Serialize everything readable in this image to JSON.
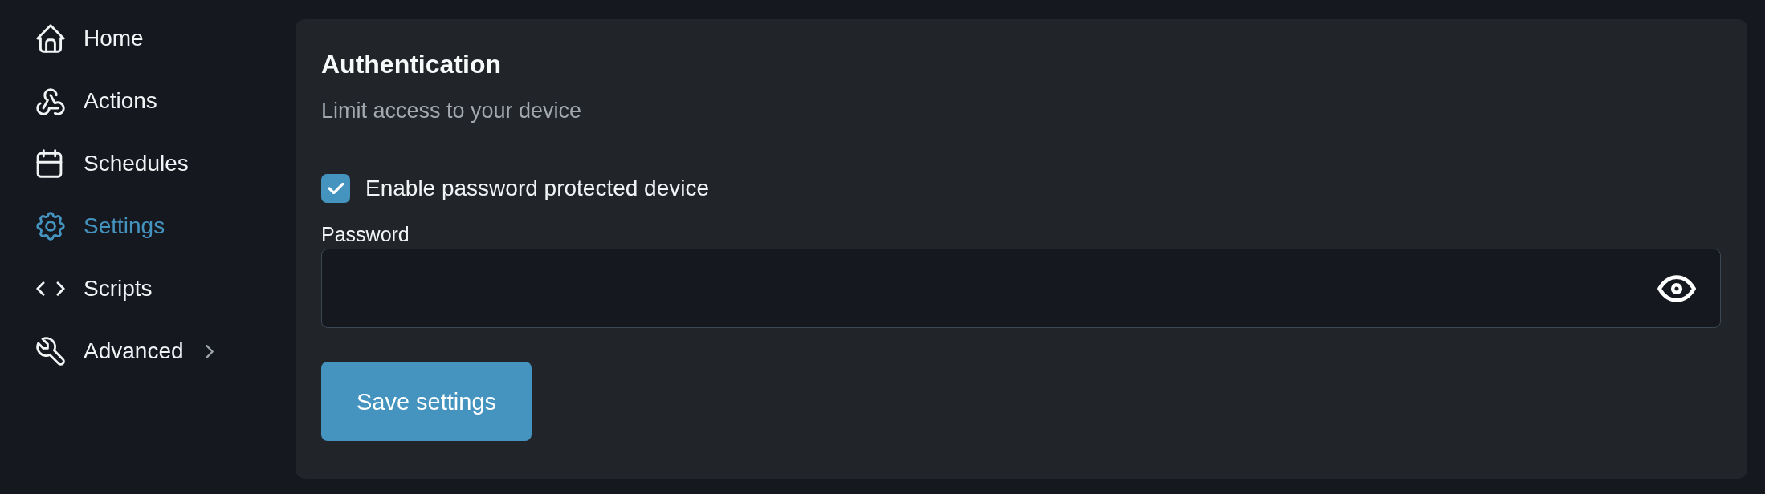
{
  "sidebar": {
    "items": [
      {
        "label": "Home",
        "kind": "link",
        "selected": false
      },
      {
        "label": "Actions",
        "kind": "link",
        "selected": false
      },
      {
        "label": "Schedules",
        "kind": "link",
        "selected": false
      },
      {
        "label": "Settings",
        "kind": "link",
        "selected": true
      },
      {
        "label": "Scripts",
        "kind": "link",
        "selected": false
      },
      {
        "label": "Advanced",
        "kind": "group",
        "selected": false,
        "expanded": false
      }
    ]
  },
  "card": {
    "title": "Authentication",
    "subtitle": "Limit access to your device",
    "checkbox": {
      "label": "Enable password protected device",
      "checked": true
    },
    "password_field": {
      "label": "Password"
    },
    "save_button": {
      "label": "Save settings"
    }
  }
}
